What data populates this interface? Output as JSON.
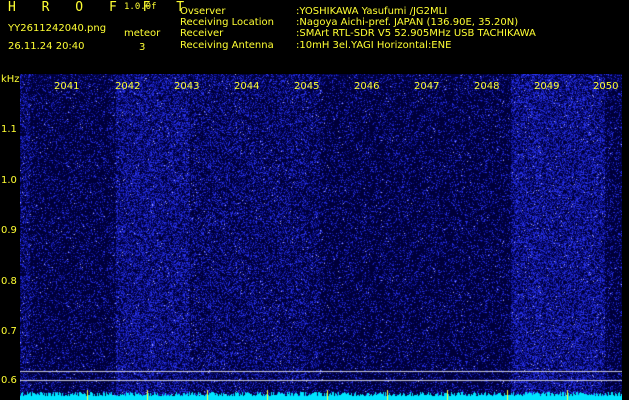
{
  "header": {
    "app_title": "H R O F F T",
    "app_version": "1.0.0f",
    "filename": "YY2611242040.png",
    "datetime": "26.11.24 20:40",
    "meteor_label": "meteor",
    "meteor_count": "3",
    "info": [
      {
        "label": "Ovserver",
        "value": ":YOSHIKAWA Yasufumi /JG2MLI"
      },
      {
        "label": "Receiving Location",
        "value": ":Nagoya Aichi-pref. JAPAN (136.90E, 35.20N)"
      },
      {
        "label": "Receiver",
        "value": ":SMArt RTL-SDR V5 52.905MHz USB TACHIKAWA"
      },
      {
        "label": "Receiving Antenna",
        "value": ":10mH 3el.YAGI Horizontal:ENE"
      }
    ]
  },
  "spectrogram": {
    "y_unit": "kHz",
    "y_ticks": [
      "1.1",
      "1.0",
      "0.9",
      "0.8",
      "0.7",
      "0.6"
    ],
    "x_ticks": [
      "2041",
      "2042",
      "2043",
      "2044",
      "2045",
      "2046",
      "2047",
      "2048",
      "2049",
      "2050"
    ],
    "colors": {
      "background": "#00003a",
      "signal": "#3333ff",
      "bright": "#aaaaff",
      "baseline": "#00e5ff",
      "label": "#ffff33"
    }
  }
}
